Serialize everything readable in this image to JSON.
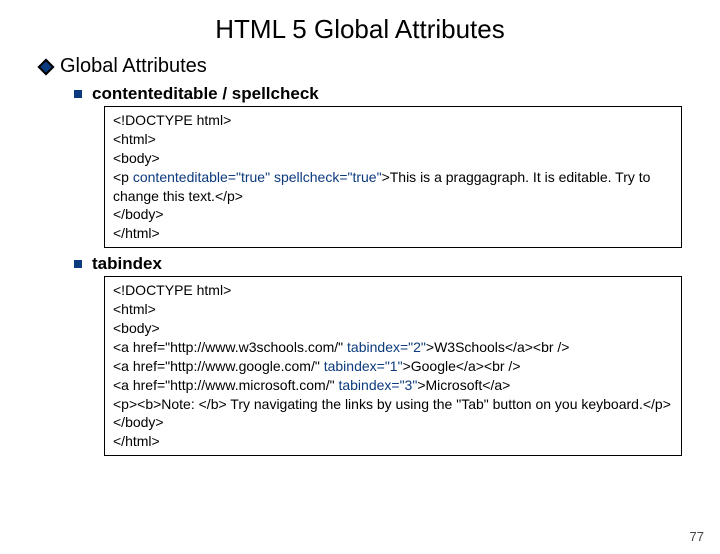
{
  "title": "HTML 5 Global Attributes",
  "section": "Global Attributes",
  "items": [
    {
      "heading": "contenteditable / spellcheck",
      "code": [
        {
          "t": "<!DOCTYPE html>"
        },
        {
          "t": "<html>"
        },
        {
          "t": "<body>"
        },
        {
          "pre": "<p ",
          "hl": "contenteditable=\"true\" spellcheck=\"true\"",
          "post": ">This is a praggagraph. It is editable. Try to change this text.</p>"
        },
        {
          "t": "</body>"
        },
        {
          "t": "</html>"
        }
      ]
    },
    {
      "heading": "tabindex",
      "code": [
        {
          "t": "<!DOCTYPE html>"
        },
        {
          "t": "<html>"
        },
        {
          "t": "<body>"
        },
        {
          "pre": "<a href=\"http://www.w3schools.com/\" ",
          "hl": "tabindex=\"2\"",
          "post": ">W3Schools</a><br />"
        },
        {
          "pre": "<a href=\"http://www.google.com/\" ",
          "hl": "tabindex=\"1\"",
          "post": ">Google</a><br />"
        },
        {
          "pre": "<a href=\"http://www.microsoft.com/\" ",
          "hl": "tabindex=\"3\"",
          "post": ">Microsoft</a>"
        },
        {
          "t": "<p><b>Note: </b> Try navigating the links by using the \"Tab\" button on you keyboard.</p>"
        },
        {
          "t": "</body>"
        },
        {
          "t": "</html>"
        }
      ]
    }
  ],
  "page": "77"
}
